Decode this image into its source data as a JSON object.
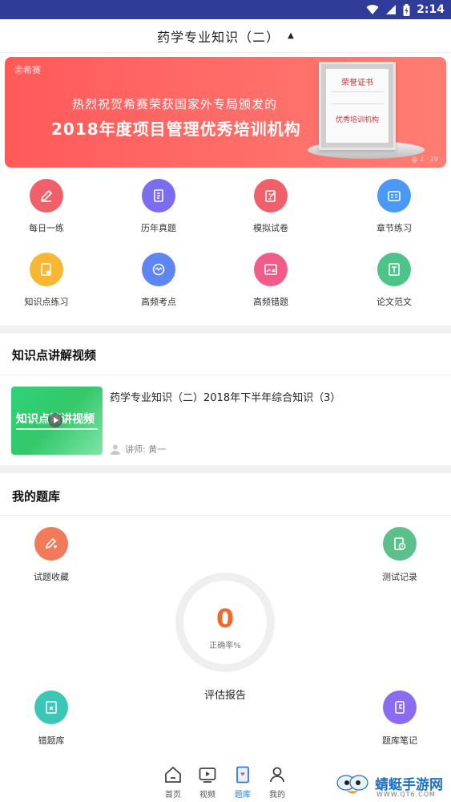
{
  "status_bar": {
    "time": "2:14"
  },
  "header": {
    "title": "药学专业知识（二）",
    "caret": "▲"
  },
  "banner": {
    "logo": "㊎希赛",
    "line1": "热烈祝贺希赛荣获国家外专局颁发的",
    "line2": "2018年度项目管理优秀培训机构",
    "cert_title": "荣誉证书",
    "cert_red": "优秀培训机构",
    "tag": "@ 2 · 29"
  },
  "grid": [
    {
      "label": "每日一练",
      "color": "#f0606a",
      "icon": "pencil-icon"
    },
    {
      "label": "历年真题",
      "color": "#7b6cf0",
      "icon": "clipboard-icon"
    },
    {
      "label": "模拟试卷",
      "color": "#f0606a",
      "icon": "edit-doc-icon"
    },
    {
      "label": "章节练习",
      "color": "#4a9af5",
      "icon": "chapter-icon"
    },
    {
      "label": "知识点练习",
      "color": "#f7b733",
      "icon": "doc-star-icon"
    },
    {
      "label": "高频考点",
      "color": "#5e86f0",
      "icon": "chat-wave-icon"
    },
    {
      "label": "高频错题",
      "color": "#f05d8a",
      "icon": "image-x-icon"
    },
    {
      "label": "论文范文",
      "color": "#4cc48a",
      "icon": "document-icon"
    }
  ],
  "video_section": {
    "title": "知识点讲解视频",
    "thumb_text": "知识点精讲视频",
    "video_title": "药学专业知识（二）2018年下半年综合知识（3）",
    "lecturer": "讲师: 黄一"
  },
  "bank_section": {
    "title": "我的题库",
    "items": {
      "favorites": {
        "label": "试题收藏",
        "color": "#f27a5a",
        "icon": "pen-heart-icon"
      },
      "records": {
        "label": "测试记录",
        "color": "#5cc08c",
        "icon": "doc-clock-icon"
      },
      "wrong": {
        "label": "错题库",
        "color": "#3ac7b8",
        "icon": "doc-x-icon"
      },
      "notes": {
        "label": "题库笔记",
        "color": "#8a6cf0",
        "icon": "notebook-icon"
      }
    },
    "accuracy_value": "0",
    "accuracy_label": "正确率%",
    "report_label": "评估报告"
  },
  "tabbar": {
    "tabs": [
      {
        "label": "首页",
        "icon": "home-icon"
      },
      {
        "label": "视频",
        "icon": "video-icon"
      },
      {
        "label": "题库",
        "icon": "question-bank-icon"
      },
      {
        "label": "我的",
        "icon": "profile-icon"
      }
    ],
    "active_index": 2
  },
  "watermark": {
    "name": "蜻蜓手游网",
    "url": "WWW.QT6.COM"
  }
}
